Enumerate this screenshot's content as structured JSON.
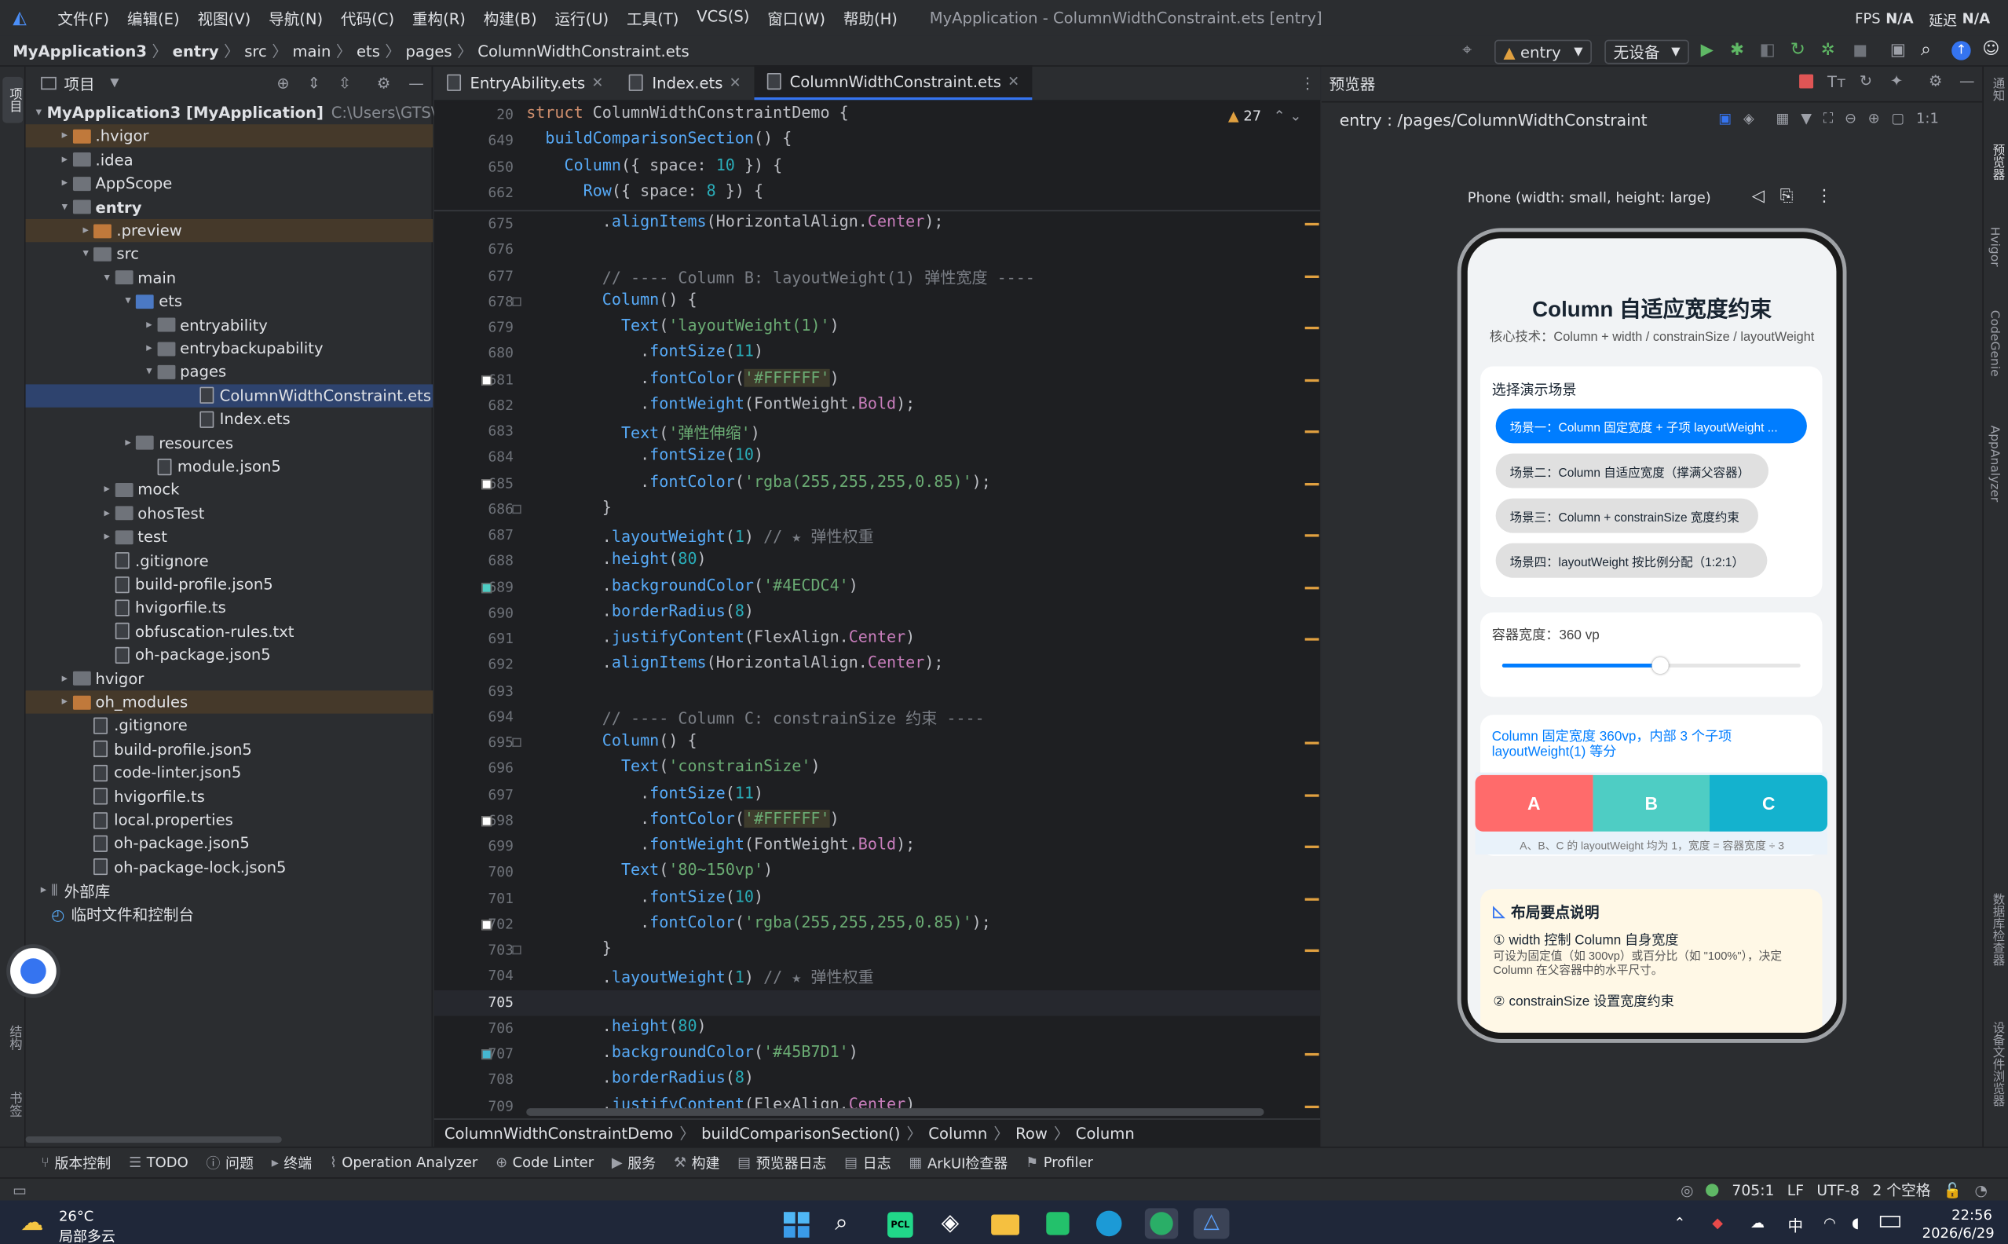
{
  "menu": [
    "文件(F)",
    "编辑(E)",
    "视图(V)",
    "导航(N)",
    "代码(C)",
    "重构(R)",
    "构建(B)",
    "运行(U)",
    "工具(T)",
    "VCS(S)",
    "窗口(W)",
    "帮助(H)"
  ],
  "window_title": "MyApplication - ColumnWidthConstraint.ets [entry]",
  "fps": {
    "label_a": "FPS",
    "value_a": "N/A",
    "label_b": "延迟",
    "value_b": "N/A"
  },
  "breadcrumb": [
    "MyApplication3",
    "entry",
    "src",
    "main",
    "ets",
    "pages",
    "ColumnWidthConstraint.ets"
  ],
  "toolbar": {
    "module": "entry",
    "device": "无设备"
  },
  "project": {
    "title": "项目",
    "rows": [
      {
        "label": "MyApplication3 [MyApplication]",
        "extra": "C:\\Users\\GTS\\Devl",
        "indent": 0,
        "arrow": "▾",
        "icon": "folder",
        "bold": true
      },
      {
        "label": ".hvigor",
        "indent": 1,
        "arrow": "▸",
        "icon": "folder-orange",
        "hl": true
      },
      {
        "label": ".idea",
        "indent": 1,
        "arrow": "▸",
        "icon": "folder"
      },
      {
        "label": "AppScope",
        "indent": 1,
        "arrow": "▸",
        "icon": "folder"
      },
      {
        "label": "entry",
        "indent": 1,
        "arrow": "▾",
        "icon": "folder",
        "bold": true
      },
      {
        "label": ".preview",
        "indent": 2,
        "arrow": "▸",
        "icon": "folder-orange",
        "hl": true
      },
      {
        "label": "src",
        "indent": 2,
        "arrow": "▾",
        "icon": "folder"
      },
      {
        "label": "main",
        "indent": 3,
        "arrow": "▾",
        "icon": "folder"
      },
      {
        "label": "ets",
        "indent": 4,
        "arrow": "▾",
        "icon": "folder"
      },
      {
        "label": "entryability",
        "indent": 5,
        "arrow": "▸",
        "icon": "folder"
      },
      {
        "label": "entrybackupability",
        "indent": 5,
        "arrow": "▸",
        "icon": "folder"
      },
      {
        "label": "pages",
        "indent": 5,
        "arrow": "▾",
        "icon": "folder"
      },
      {
        "label": "ColumnWidthConstraint.ets",
        "indent": 7,
        "arrow": "",
        "icon": "file",
        "sel": true
      },
      {
        "label": "Index.ets",
        "indent": 7,
        "arrow": "",
        "icon": "file"
      },
      {
        "label": "resources",
        "indent": 4,
        "arrow": "▸",
        "icon": "folder"
      },
      {
        "label": "module.json5",
        "indent": 5,
        "arrow": "",
        "icon": "file"
      },
      {
        "label": "mock",
        "indent": 3,
        "arrow": "▸",
        "icon": "folder"
      },
      {
        "label": "ohosTest",
        "indent": 3,
        "arrow": "▸",
        "icon": "folder"
      },
      {
        "label": "test",
        "indent": 3,
        "arrow": "▸",
        "icon": "folder"
      },
      {
        "label": ".gitignore",
        "indent": 3,
        "arrow": "",
        "icon": "file"
      },
      {
        "label": "build-profile.json5",
        "indent": 3,
        "arrow": "",
        "icon": "file"
      },
      {
        "label": "hvigorfile.ts",
        "indent": 3,
        "arrow": "",
        "icon": "file"
      },
      {
        "label": "obfuscation-rules.txt",
        "indent": 3,
        "arrow": "",
        "icon": "file"
      },
      {
        "label": "oh-package.json5",
        "indent": 3,
        "arrow": "",
        "icon": "file"
      },
      {
        "label": "hvigor",
        "indent": 1,
        "arrow": "▸",
        "icon": "folder"
      },
      {
        "label": "oh_modules",
        "indent": 1,
        "arrow": "▸",
        "icon": "folder-orange",
        "hl": true
      },
      {
        "label": ".gitignore",
        "indent": 2,
        "arrow": "",
        "icon": "file"
      },
      {
        "label": "build-profile.json5",
        "indent": 2,
        "arrow": "",
        "icon": "file"
      },
      {
        "label": "code-linter.json5",
        "indent": 2,
        "arrow": "",
        "icon": "file"
      },
      {
        "label": "hvigorfile.ts",
        "indent": 2,
        "arrow": "",
        "icon": "file"
      },
      {
        "label": "local.properties",
        "indent": 2,
        "arrow": "",
        "icon": "file"
      },
      {
        "label": "oh-package.json5",
        "indent": 2,
        "arrow": "",
        "icon": "file"
      },
      {
        "label": "oh-package-lock.json5",
        "indent": 2,
        "arrow": "",
        "icon": "file"
      },
      {
        "label": "外部库",
        "indent": 0,
        "arrow": "▸",
        "icon": "lib"
      },
      {
        "label": "临时文件和控制台",
        "indent": 0,
        "arrow": "",
        "icon": "scratch"
      }
    ]
  },
  "editor": {
    "tabs": [
      {
        "label": "EntryAbility.ets",
        "active": false
      },
      {
        "label": "Index.ets",
        "active": false
      },
      {
        "label": "ColumnWidthConstraint.ets",
        "active": true
      }
    ],
    "warnings": "27",
    "sticky": [
      {
        "n": "20",
        "html": "<span class='kw'>struct</span> <span class='cls' style='color:#bcbec4'>ColumnWidthConstraintDemo</span> {"
      },
      {
        "n": "649",
        "html": "  <span class='df'>buildComparisonSection</span>() {"
      },
      {
        "n": "650",
        "html": "    <span class='fn'>Column</span>({ space: <span class='nm'>10</span> }) {"
      },
      {
        "n": "662",
        "html": "      <span class='fn'>Row</span>({ space: <span class='nm'>8</span> }) {"
      }
    ],
    "lines": [
      {
        "n": "675",
        "html": "        .<span class='fn'>alignItems</span>(HorizontalAlign.<span class='pr'>Center</span>);"
      },
      {
        "n": "676",
        "html": ""
      },
      {
        "n": "677",
        "html": "        <span class='cm'>// ---- Column B: layoutWeight(1) 弹性宽度 ----</span>"
      },
      {
        "n": "678",
        "html": "        <span class='fn'>Column</span>() {"
      },
      {
        "n": "679",
        "html": "          <span class='fn'>Text</span>(<span class='st'>'layoutWeight(1)'</span>)"
      },
      {
        "n": "680",
        "html": "            .<span class='fn'>fontSize</span>(<span class='nm'>11</span>)"
      },
      {
        "n": "681",
        "html": "            .<span class='fn'>fontColor</span>(<span class='st' style='background:#3d3b2c'>'#FFFFFF'</span>)",
        "sw": "#ffffff"
      },
      {
        "n": "682",
        "html": "            .<span class='fn'>fontWeight</span>(FontWeight.<span class='pr'>Bold</span>);"
      },
      {
        "n": "683",
        "html": "          <span class='fn'>Text</span>(<span class='st'>'弹性伸缩'</span>)"
      },
      {
        "n": "684",
        "html": "            .<span class='fn'>fontSize</span>(<span class='nm'>10</span>)"
      },
      {
        "n": "685",
        "html": "            .<span class='fn'>fontColor</span>(<span class='st'>'rgba(255,255,255,0.85)'</span>);",
        "sw": "#ffffff"
      },
      {
        "n": "686",
        "html": "        }"
      },
      {
        "n": "687",
        "html": "        .<span class='fn'>layoutWeight</span>(<span class='nm'>1</span>) <span class='cm'>// ★ 弹性权重</span>"
      },
      {
        "n": "688",
        "html": "        .<span class='fn'>height</span>(<span class='nm'>80</span>)"
      },
      {
        "n": "689",
        "html": "        .<span class='fn'>backgroundColor</span>(<span class='st'>'#4ECDC4'</span>)",
        "sw": "#4ecdc4"
      },
      {
        "n": "690",
        "html": "        .<span class='fn'>borderRadius</span>(<span class='nm'>8</span>)"
      },
      {
        "n": "691",
        "html": "        .<span class='fn'>justifyContent</span>(FlexAlign.<span class='pr'>Center</span>)"
      },
      {
        "n": "692",
        "html": "        .<span class='fn'>alignItems</span>(HorizontalAlign.<span class='pr'>Center</span>);"
      },
      {
        "n": "693",
        "html": ""
      },
      {
        "n": "694",
        "html": "        <span class='cm'>// ---- Column C: constrainSize 约束 ----</span>"
      },
      {
        "n": "695",
        "html": "        <span class='fn'>Column</span>() {"
      },
      {
        "n": "696",
        "html": "          <span class='fn'>Text</span>(<span class='st'>'constrainSize'</span>)"
      },
      {
        "n": "697",
        "html": "            .<span class='fn'>fontSize</span>(<span class='nm'>11</span>)"
      },
      {
        "n": "698",
        "html": "            .<span class='fn'>fontColor</span>(<span class='st' style='background:#3d3b2c'>'#FFFFFF'</span>)",
        "sw": "#ffffff"
      },
      {
        "n": "699",
        "html": "            .<span class='fn'>fontWeight</span>(FontWeight.<span class='pr'>Bold</span>);"
      },
      {
        "n": "700",
        "html": "          <span class='fn'>Text</span>(<span class='st'>'80~150vp'</span>)"
      },
      {
        "n": "701",
        "html": "            .<span class='fn'>fontSize</span>(<span class='nm'>10</span>)"
      },
      {
        "n": "702",
        "html": "            .<span class='fn'>fontColor</span>(<span class='st'>'rgba(255,255,255,0.85)'</span>);",
        "sw": "#ffffff"
      },
      {
        "n": "703",
        "html": "        }"
      },
      {
        "n": "704",
        "html": "        .<span class='fn'>layoutWeight</span>(<span class='nm'>1</span>) <span class='cm'>// ★ 弹性权重</span>"
      },
      {
        "n": "705",
        "html": "",
        "cur": true
      },
      {
        "n": "706",
        "html": "        .<span class='fn'>height</span>(<span class='nm'>80</span>)"
      },
      {
        "n": "707",
        "html": "        .<span class='fn'>backgroundColor</span>(<span class='st'>'#45B7D1'</span>)",
        "sw": "#45b7d1"
      },
      {
        "n": "708",
        "html": "        .<span class='fn'>borderRadius</span>(<span class='nm'>8</span>)"
      },
      {
        "n": "709",
        "html": "        .<span class='fn'>justifyContent</span>(FlexAlign.<span class='pr'>Center</span>)"
      }
    ],
    "code_breadcrumb": [
      "ColumnWidthConstraintDemo",
      "buildComparisonSection()",
      "Column",
      "Row",
      "Column"
    ]
  },
  "previewer": {
    "title": "预览器",
    "path": "entry : /pages/ColumnWidthConstraint",
    "device_label": "Phone (width: small, height: large)",
    "app": {
      "title": "Column 自适应宽度约束",
      "subtitle": "核心技术：Column + width / constrainSize / layoutWeight",
      "scene_heading": "选择演示场景",
      "scenes": [
        "场景一：Column 固定宽度 + 子项 layoutWeight ...",
        "场景二：Column 自适应宽度（撑满父容器）",
        "场景三：Column + constrainSize 宽度约束",
        "场景四：layoutWeight 按比例分配（1:2:1）"
      ],
      "width_label": "容器宽度：360 vp",
      "slider_value": 0.53,
      "desc_line1": "Column 固定宽度 360vp，内部 3 个子项",
      "desc_line2": "layoutWeight(1) 等分",
      "boxes": [
        {
          "label": "A",
          "color": "#ff6b6b"
        },
        {
          "label": "B",
          "color": "#4ecdc4"
        },
        {
          "label": "C",
          "color": "#14b2ce"
        }
      ],
      "boxes_note": "A、B、C 的 layoutWeight 均为 1，宽度 = 容器宽度 ÷ 3",
      "tips_title": "布局要点说明",
      "tip1_title": "① width 控制 Column 自身宽度",
      "tip1_body1": "可设为固定值（如 300vp）或百分比（如 \"100%\"），决定",
      "tip1_body2": "Column 在父容器中的水平尺寸。",
      "tip2_title": "② constrainSize 设置宽度约束"
    }
  },
  "bottom_tools": [
    "版本控制",
    "TODO",
    "问题",
    "终端",
    "Operation Analyzer",
    "Code Linter",
    "服务",
    "构建",
    "预览器日志",
    "日志",
    "ArkUI检查器",
    "Profiler"
  ],
  "status": {
    "pos": "705:1",
    "eol": "LF",
    "enc": "UTF-8",
    "indent": "2 个空格"
  },
  "left_stripe": {
    "project": "项目",
    "structure": "结构",
    "bookmarks": "书签"
  },
  "right_stripe": [
    "通知",
    "预览器",
    "Hvigor",
    "CodeGenie",
    "AppAnalyzer",
    "数据库检查器",
    "设备文件浏览器"
  ],
  "taskbar": {
    "temp": "26°C",
    "weather": "局部多云",
    "time": "22:56",
    "date": "2026/6/29",
    "ime": "中"
  },
  "colors": {
    "accent": "#3574f0",
    "selected_chip": "#007dff"
  }
}
